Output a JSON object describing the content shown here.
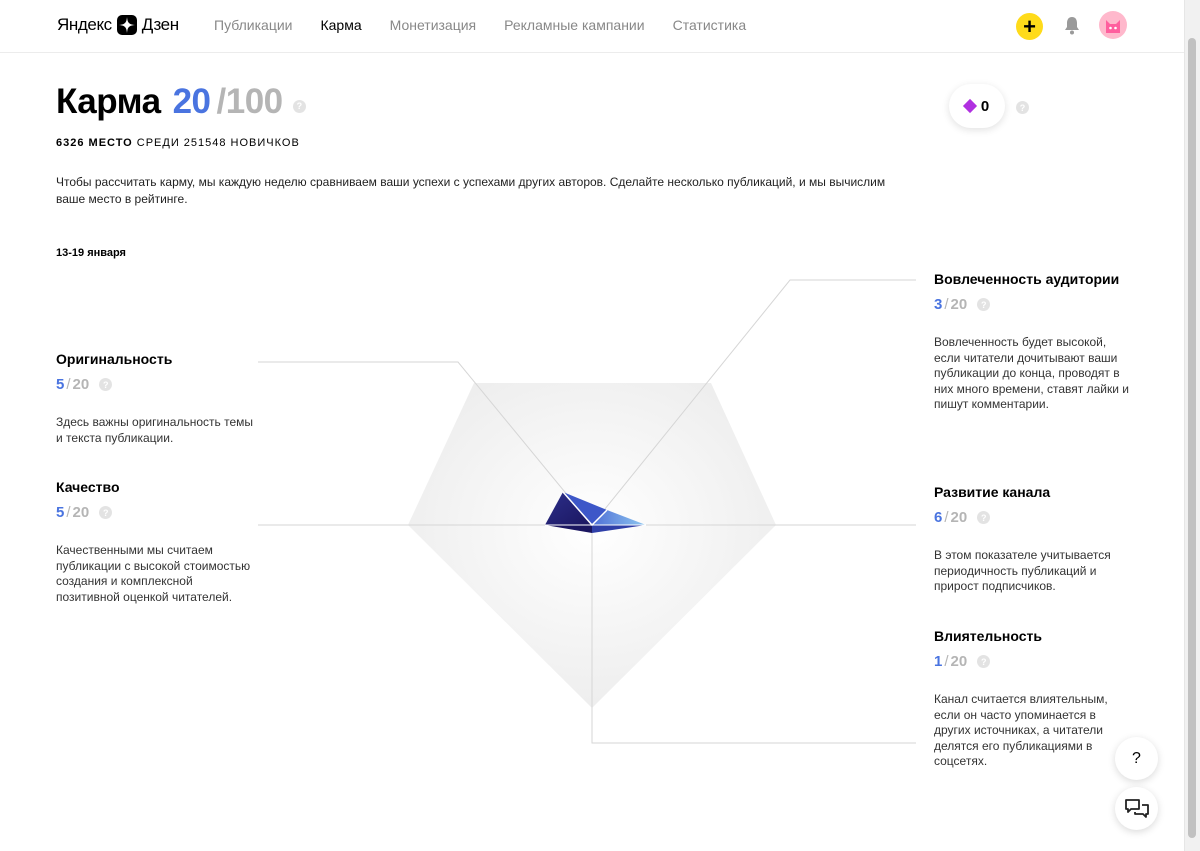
{
  "header": {
    "logo_text": "Яндекс",
    "logo_zen": "Дзен",
    "nav": [
      {
        "label": "Публикации",
        "active": false
      },
      {
        "label": "Карма",
        "active": true
      },
      {
        "label": "Монетизация",
        "active": false
      },
      {
        "label": "Рекламные кампании",
        "active": false
      },
      {
        "label": "Статистика",
        "active": false
      }
    ],
    "plus_label": "+"
  },
  "karma": {
    "title": "Карма",
    "score": "20",
    "max": "/100",
    "help": "?",
    "rank_place": "6326 МЕСТО",
    "rank_rest": "СРЕДИ 251548 НОВИЧКОВ",
    "intro": "Чтобы рассчитать карму, мы каждую неделю сравниваем ваши успехи с успехами других авторов. Сделайте несколько публикаций, и мы вычислим ваше место в рейтинге.",
    "period": "13-19 января"
  },
  "badge": {
    "value": "0",
    "color": "#b030e0",
    "help": "?"
  },
  "metrics": {
    "originality": {
      "title": "Оригинальность",
      "value": "5",
      "max": "20",
      "help": "?",
      "desc": "Здесь важны оригинальность темы и текста публикации."
    },
    "quality": {
      "title": "Качество",
      "value": "5",
      "max": "20",
      "help": "?",
      "desc": "Качественными мы считаем публикации с высокой стоимостью создания и комплексной позитивной оценкой читателей."
    },
    "engagement": {
      "title": "Вовлеченность аудитории",
      "value": "3",
      "max": "20",
      "help": "?",
      "desc": "Вовлеченность будет высокой, если читатели дочитывают ваши публикации до конца, проводят в них много времени, ставят лайки и пишут комментарии."
    },
    "growth": {
      "title": "Развитие канала",
      "value": "6",
      "max": "20",
      "help": "?",
      "desc": "В этом показателе учитывается периодичность публикаций и прирост подписчиков."
    },
    "influence": {
      "title": "Влиятельность",
      "value": "1",
      "max": "20",
      "help": "?",
      "desc": "Канал считается влиятельным, если он часто упоминается в других источниках, а читатели делятся его публикациями в соцсетях."
    }
  },
  "colors": {
    "accent": "#4a74e0",
    "muted": "#b5b5b5",
    "plus": "#ffdb1a"
  },
  "fab": {
    "help": "?",
    "chat_icon": "chat-icon"
  }
}
